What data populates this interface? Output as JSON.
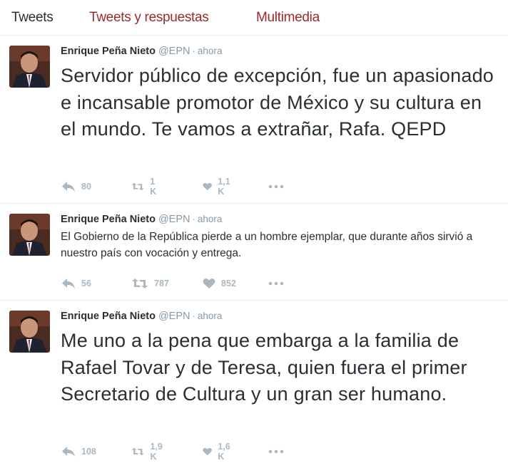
{
  "tabs": [
    {
      "label": "Tweets"
    },
    {
      "label": "Tweets y respuestas"
    },
    {
      "label": "Multimedia"
    }
  ],
  "colors": {
    "active_tab": "#292f33",
    "inactive_tab": "#9b2a2a",
    "text": "#292f33",
    "muted": "#8899a6",
    "action_gray": "#aab8c2",
    "divider": "#e6ecf0"
  },
  "tweets": [
    {
      "name": "Enrique Peña Nieto",
      "handle": "@EPN",
      "separator": "·",
      "time": "ahora",
      "text": "Servidor público de excepción, fue un apasionado e incansable promotor de México y su cultura en el mundo. Te vamos a extrañar, Rafa. QEPD",
      "replies": "80",
      "retweets": "1 K",
      "likes": "1,1 K",
      "more_icon": "more-icon"
    },
    {
      "name": "Enrique Peña Nieto",
      "handle": "@EPN",
      "separator": "·",
      "time": "ahora",
      "text": "El Gobierno de la República pierde a un hombre ejemplar, que durante años sirvió a nuestro país con vocación y entrega.",
      "replies": "56",
      "retweets": "787",
      "likes": "852",
      "more_icon": "more-icon"
    },
    {
      "name": "Enrique Peña Nieto",
      "handle": "@EPN",
      "separator": "·",
      "time": "ahora",
      "text": "Me uno a la pena que embarga a la familia de Rafael Tovar y de Teresa, quien fuera el primer Secretario de Cultura y un gran ser humano.",
      "replies": "108",
      "retweets": "1,9 K",
      "likes": "1,6 K",
      "more_icon": "more-icon"
    }
  ]
}
